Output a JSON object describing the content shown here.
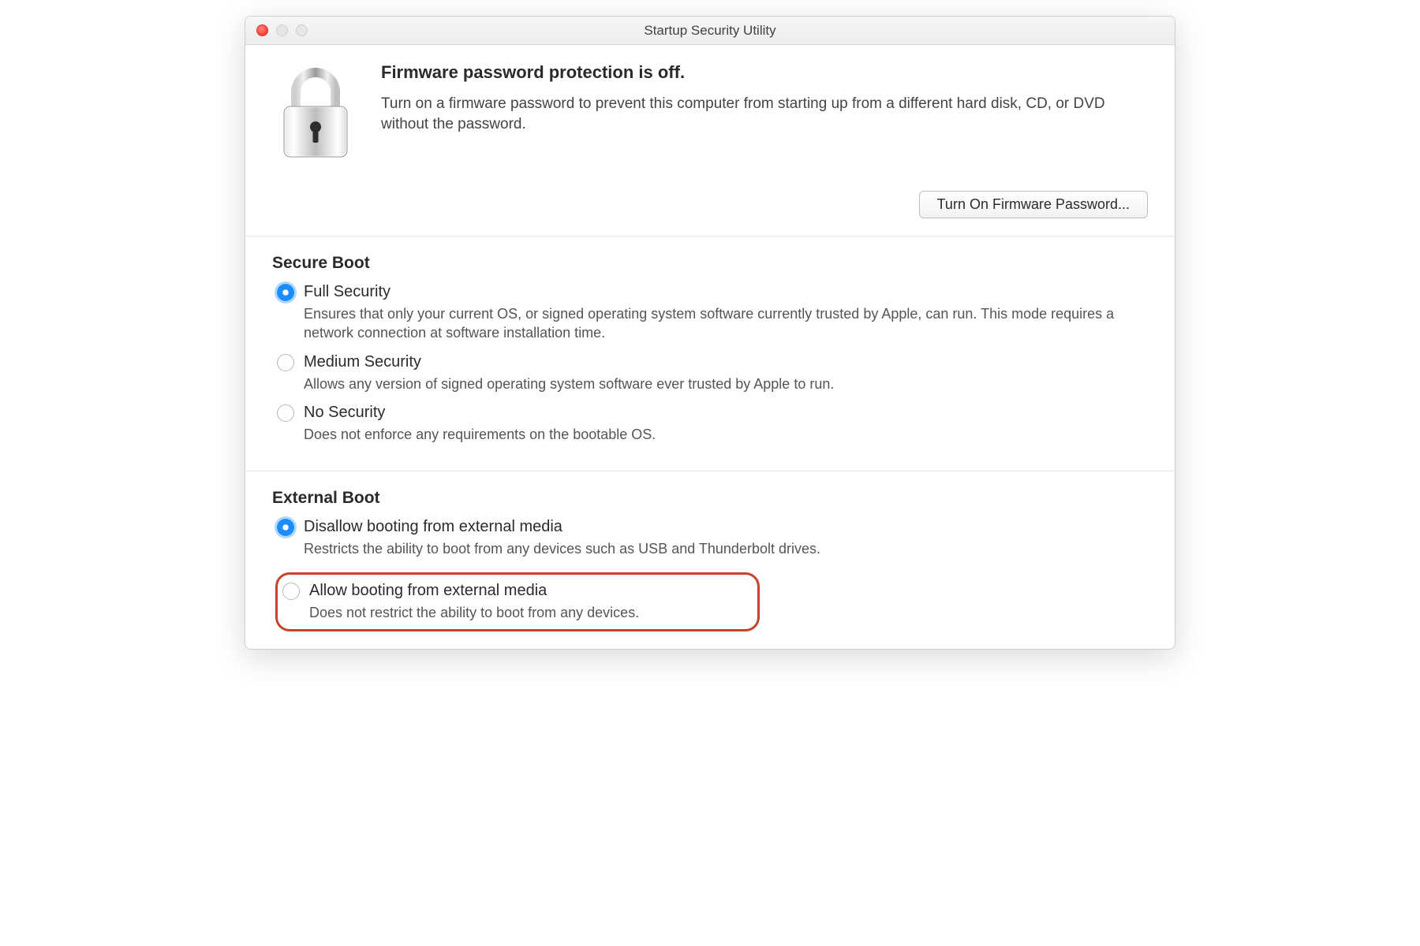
{
  "window": {
    "title": "Startup Security Utility"
  },
  "firmware": {
    "heading": "Firmware password protection is off.",
    "description": "Turn on a firmware password to prevent this computer from starting up from a different hard disk, CD, or DVD without the password.",
    "button_label": "Turn On Firmware Password..."
  },
  "secure_boot": {
    "heading": "Secure Boot",
    "options": [
      {
        "label": "Full Security",
        "description": "Ensures that only your current OS, or signed operating system software currently trusted by Apple, can run. This mode requires a network connection at software installation time.",
        "selected": true
      },
      {
        "label": "Medium Security",
        "description": "Allows any version of signed operating system software ever trusted by Apple to run.",
        "selected": false
      },
      {
        "label": "No Security",
        "description": "Does not enforce any requirements on the bootable OS.",
        "selected": false
      }
    ]
  },
  "external_boot": {
    "heading": "External Boot",
    "options": [
      {
        "label": "Disallow booting from external media",
        "description": "Restricts the ability to boot from any devices such as USB and Thunderbolt drives.",
        "selected": true
      },
      {
        "label": "Allow booting from external media",
        "description": "Does not restrict the ability to boot from any devices.",
        "selected": false
      }
    ]
  }
}
